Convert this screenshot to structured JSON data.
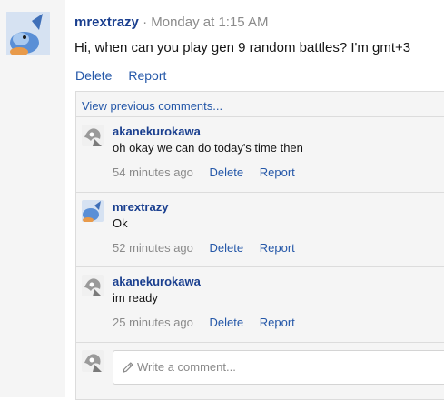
{
  "post": {
    "username": "mrextrazy",
    "separator": "·",
    "timestamp": "Monday at 1:15 AM",
    "body": "Hi, when can you play gen 9 random battles? I'm gmt+3",
    "delete_label": "Delete",
    "report_label": "Report"
  },
  "comments": {
    "view_previous": "View previous comments...",
    "items": [
      {
        "username": "akanekurokawa",
        "text": "oh okay we can do today's time then",
        "time": "54 minutes ago",
        "delete_label": "Delete",
        "report_label": "Report"
      },
      {
        "username": "mrextrazy",
        "text": "Ok",
        "time": "52 minutes ago",
        "delete_label": "Delete",
        "report_label": "Report"
      },
      {
        "username": "akanekurokawa",
        "text": "im ready",
        "time": "25 minutes ago",
        "delete_label": "Delete",
        "report_label": "Report"
      }
    ],
    "write_placeholder": "Write a comment..."
  },
  "colors": {
    "username": "#1a3f8f",
    "link": "#2457a8",
    "muted": "#8a8a8a",
    "panel": "#f5f5f5"
  }
}
